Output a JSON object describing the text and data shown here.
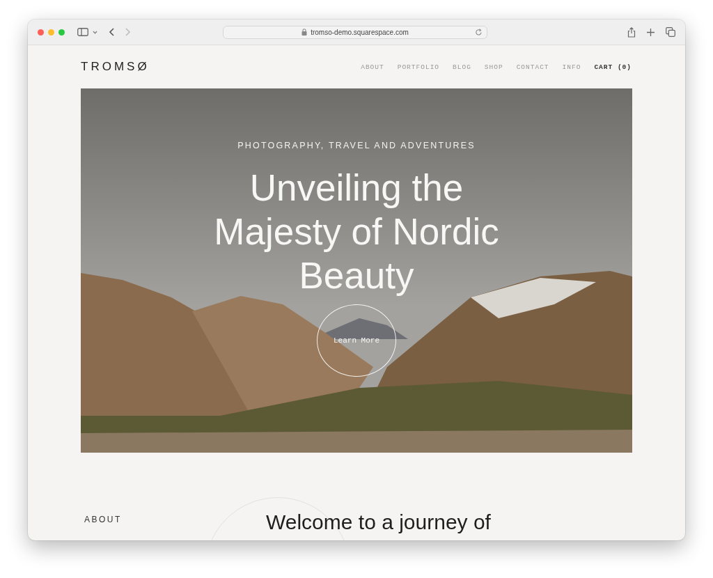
{
  "browser": {
    "url": "tromso-demo.squarespace.com"
  },
  "site": {
    "logo": "TROMSØ",
    "nav": [
      {
        "label": "ABOUT",
        "kind": "link"
      },
      {
        "label": "PORTFOLIO",
        "kind": "link"
      },
      {
        "label": "BLOG",
        "kind": "link"
      },
      {
        "label": "SHOP",
        "kind": "link"
      },
      {
        "label": "CONTACT",
        "kind": "link"
      },
      {
        "label": "INFO",
        "kind": "link"
      },
      {
        "label": "CART (0)",
        "kind": "cart"
      }
    ]
  },
  "hero": {
    "eyebrow": "PHOTOGRAPHY, TRAVEL AND ADVENTURES",
    "heading": "Unveiling the Majesty of Nordic Beauty",
    "button": "Learn More"
  },
  "about": {
    "label": "ABOUT",
    "heading": "Welcome to a journey of"
  }
}
